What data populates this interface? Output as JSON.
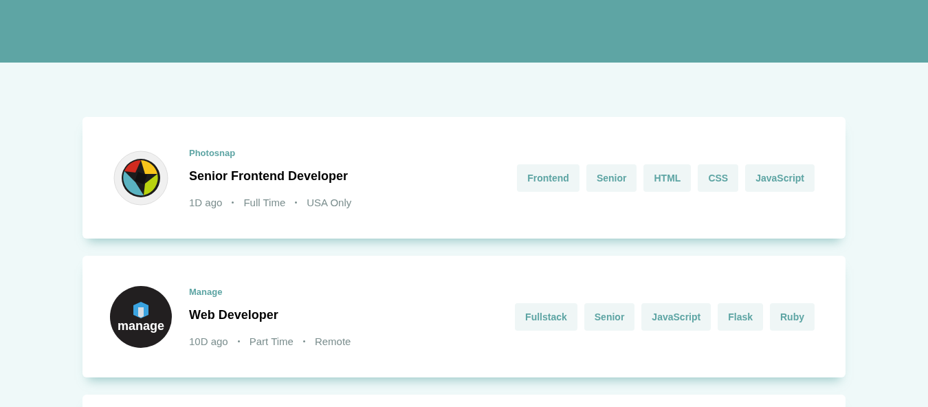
{
  "jobs": [
    {
      "kind": "listing",
      "logo": {
        "kind": "photosnap"
      },
      "company": "Photosnap",
      "position": "Senior Frontend Developer",
      "posted": "1D ago",
      "contract": "Full Time",
      "location": "USA Only",
      "tags": [
        "Frontend",
        "Senior",
        "HTML",
        "CSS",
        "JavaScript"
      ]
    },
    {
      "kind": "listing",
      "logo": {
        "kind": "manage",
        "text": "manage"
      },
      "company": "Manage",
      "position": "Web Developer",
      "posted": "10D ago",
      "contract": "Part Time",
      "location": "Remote",
      "tags": [
        "Fullstack",
        "Senior",
        "JavaScript",
        "Flask",
        "Ruby"
      ]
    },
    {
      "kind": "cut_off"
    }
  ]
}
